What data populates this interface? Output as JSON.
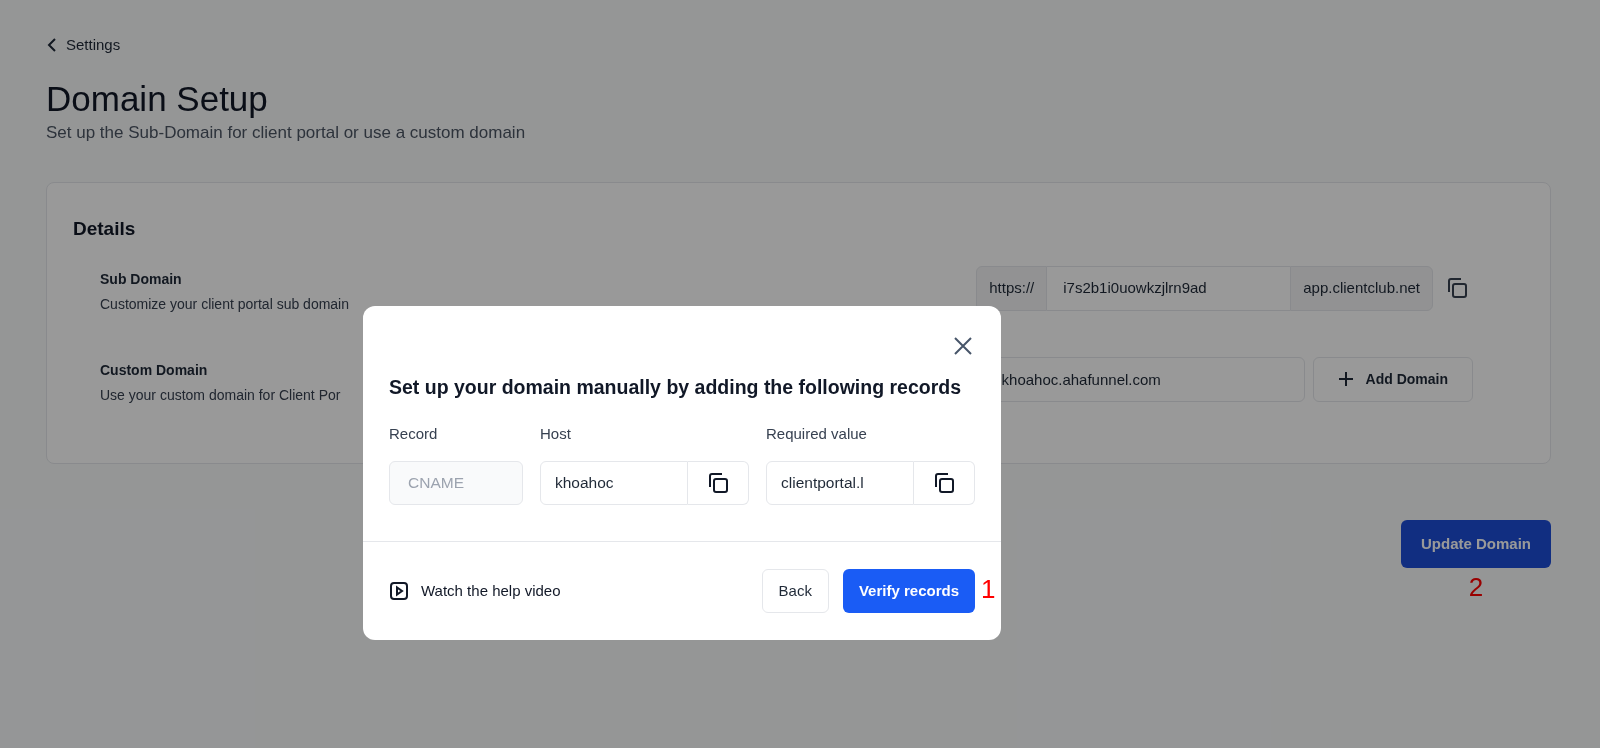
{
  "back_link": {
    "label": "Settings"
  },
  "page": {
    "title": "Domain Setup",
    "subtitle": "Set up the Sub-Domain for client portal or use a custom domain"
  },
  "details": {
    "title": "Details",
    "sub_domain": {
      "label": "Sub Domain",
      "description": "Customize your client portal sub domain",
      "prefix": "https://",
      "value": "i7s2b1i0uowkzjlrn9ad",
      "suffix": "app.clientclub.net"
    },
    "custom_domain": {
      "label": "Custom Domain",
      "description": "Use your custom domain for Client Por",
      "value": "khoahoc.ahafunnel.com",
      "button": "Add Domain"
    }
  },
  "update_button": {
    "label": "Update Domain",
    "annotation": "2"
  },
  "modal": {
    "heading": "Set up your domain manually by adding the following records",
    "fields": [
      {
        "label": "Record",
        "value": "CNAME",
        "disabled": true,
        "copyable": false
      },
      {
        "label": "Host",
        "value": "khoahoc",
        "disabled": false,
        "copyable": true
      },
      {
        "label": "Required value",
        "value": "clientportal.l",
        "disabled": false,
        "copyable": true
      }
    ],
    "help_link": "Watch the help video",
    "back_button": "Back",
    "verify_button": "Verify records",
    "annotation": "1"
  }
}
